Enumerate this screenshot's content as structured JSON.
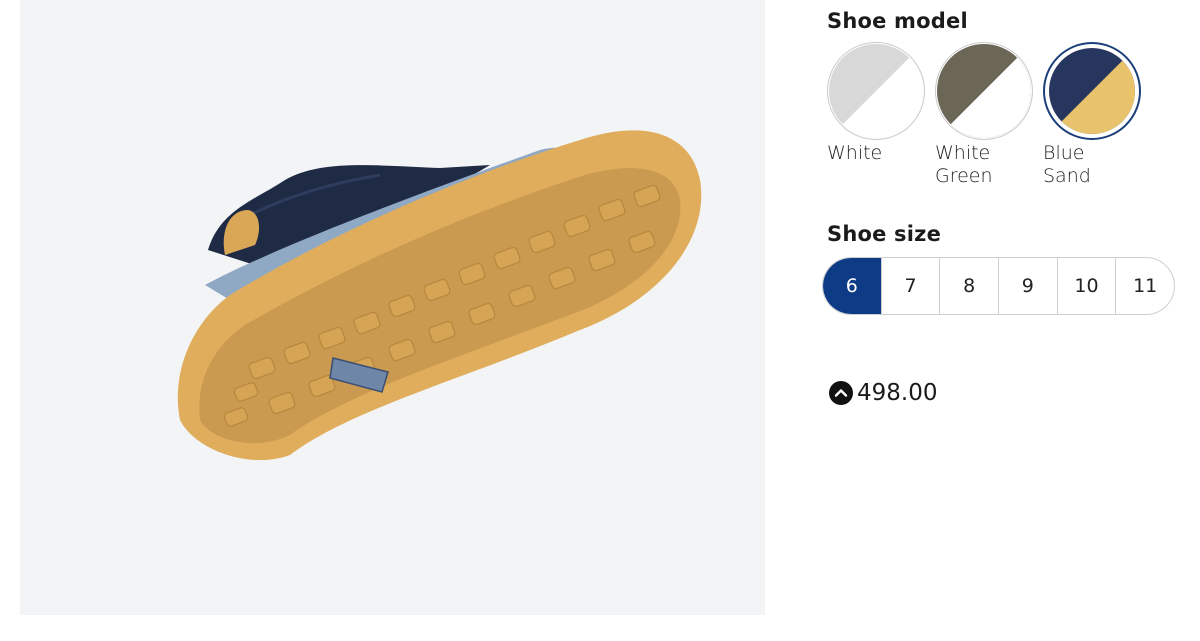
{
  "product_viewer": {
    "image_alt": "Shoe rendered from below showing sole"
  },
  "shoe_model": {
    "title": "Shoe model",
    "options": [
      {
        "label_line1": "White",
        "label_line2": "",
        "color_a": "#d8d8d8",
        "color_b": "#ffffff",
        "selected": false
      },
      {
        "label_line1": "White",
        "label_line2": "Green",
        "color_a": "#6b6656",
        "color_b": "#ffffff",
        "selected": false
      },
      {
        "label_line1": "Blue",
        "label_line2": "Sand",
        "color_a": "#26365e",
        "color_b": "#e8c36c",
        "selected": true
      }
    ]
  },
  "shoe_size": {
    "title": "Shoe size",
    "options": [
      "6",
      "7",
      "8",
      "9",
      "10",
      "11"
    ],
    "selected": "6"
  },
  "price": {
    "value": "498.00",
    "currency_icon": "chevron-up-circle-icon"
  },
  "colors": {
    "accent": "#0d3b86",
    "viewer_bg": "#f2f4f6",
    "sole": "#e0ad5c",
    "upper": "#1f2a44"
  }
}
